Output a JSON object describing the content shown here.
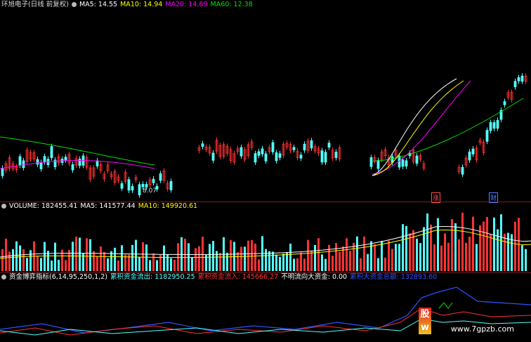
{
  "header": {
    "stock": "环旭电子(日线 前复权)",
    "ma5": "MA5: 14.55",
    "ma10": "MA10: 14.94",
    "ma20": "MA20: 14.89",
    "ma60": "MA60: 12.38"
  },
  "markers": {
    "low": "8.07",
    "zhang": "涨",
    "cai": "财"
  },
  "volume_header": {
    "label": "VOLUME: 182455.41",
    "ma5": "MA5: 141577.44",
    "ma10": "MA10: 149920.61"
  },
  "indicator_header": {
    "label": "资金博弈指标(6,14,95,250,1,2)",
    "out": "累积资金流出: 1182950.25",
    "in": "累积资金流入: 145666.27",
    "unknown": "不明流向大资金: 0.00",
    "big": "累积大资金总额: 132893.60"
  },
  "watermark": "www.7gpzb.com",
  "colors": {
    "up": "#ff3232",
    "down": "#54ffff",
    "ma5": "#ffffff",
    "ma10": "#ffff00",
    "ma20": "#ff00ff",
    "ma60": "#00e000",
    "grid": "#7a1f1f"
  },
  "chart_data": [
    {
      "type": "candlestick",
      "title": "环旭电子(日线 前复权)",
      "series": [
        {
          "name": "MA5",
          "values": [
            14.55
          ]
        },
        {
          "name": "MA10",
          "values": [
            14.94
          ]
        },
        {
          "name": "MA20",
          "values": [
            14.89
          ]
        },
        {
          "name": "MA60",
          "values": [
            12.38
          ]
        }
      ],
      "annotations": [
        "8.07"
      ]
    },
    {
      "type": "bar",
      "title": "VOLUME",
      "series": [
        {
          "name": "VOLUME",
          "values": [
            182455.41
          ]
        },
        {
          "name": "MA5",
          "values": [
            141577.44
          ]
        },
        {
          "name": "MA10",
          "values": [
            149920.61
          ]
        }
      ]
    },
    {
      "type": "line",
      "title": "资金博弈指标(6,14,95,250,1,2)",
      "series": [
        {
          "name": "累积资金流出",
          "values": [
            1182950.25
          ]
        },
        {
          "name": "累积资金流入",
          "values": [
            145666.27
          ]
        },
        {
          "name": "不明流向大资金",
          "values": [
            0.0
          ]
        },
        {
          "name": "累积大资金总额",
          "values": [
            132893.6
          ]
        }
      ]
    }
  ]
}
